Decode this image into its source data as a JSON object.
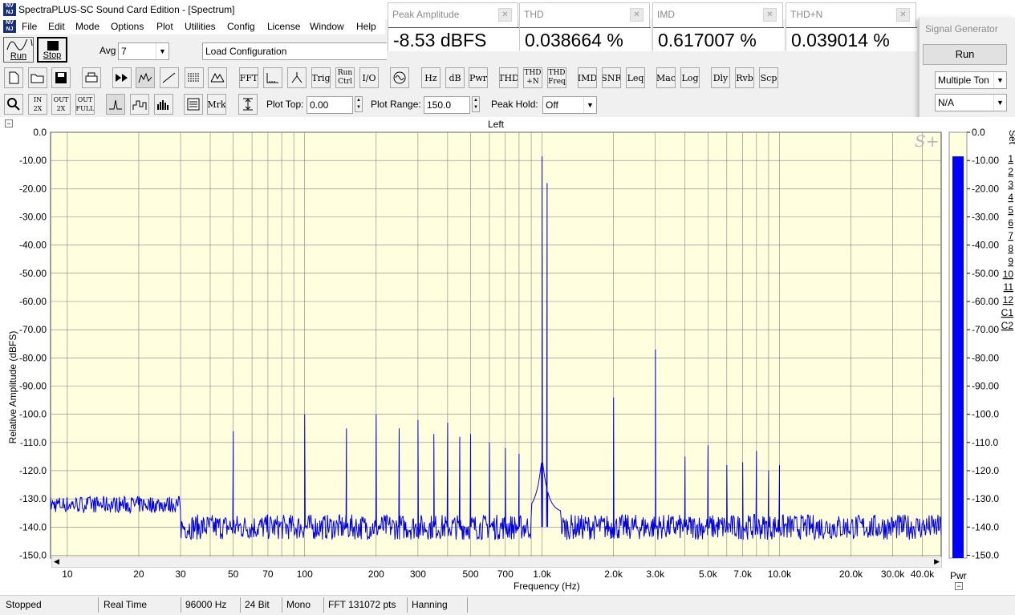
{
  "app": {
    "title": "SpectraPLUS-SC Sound Card Edition - [Spectrum]"
  },
  "menu": [
    "File",
    "Edit",
    "Mode",
    "Options",
    "Plot",
    "Utilities",
    "Config",
    "License",
    "Window",
    "Help"
  ],
  "meters": [
    {
      "label": "Peak Amplitude",
      "value": "-8.53 dBFS"
    },
    {
      "label": "THD",
      "value": "0.038664 %"
    },
    {
      "label": "IMD",
      "value": "0.617007 %"
    },
    {
      "label": "THD+N",
      "value": "0.039014 %"
    }
  ],
  "signal_generator": {
    "title": "Signal Generator",
    "run_label": "Run",
    "waveform": "Multiple Ton",
    "option": "N/A"
  },
  "toolbar": {
    "run_label": "Run",
    "stop_label": "Stop",
    "avg_label": "Avg",
    "avg_value": "7",
    "config_value": "Load Configuration",
    "buttons": [
      "FFT",
      "Trig",
      "Run Ctrl",
      "I/O",
      "Hz",
      "dB",
      "Pwr",
      "THD",
      "THD +N",
      "THD Freq",
      "IMD",
      "SNR",
      "Leq",
      "Mac",
      "Log",
      "Dly",
      "Rvb",
      "Scp"
    ],
    "zoom_buttons": [
      "Mrk"
    ],
    "plot_top_label": "Plot Top:",
    "plot_top_value": "0.00",
    "plot_range_label": "Plot Range:",
    "plot_range_value": "150.0",
    "peak_hold_label": "Peak Hold:",
    "peak_hold_value": "Off"
  },
  "plot": {
    "channel_title": "Left",
    "ylabel": "Relative Amplitude (dBFS)",
    "xlabel": "Frequency (Hz)",
    "watermark": "S+",
    "yticks": [
      "0.0",
      "-10.00",
      "-20.00",
      "-30.00",
      "-40.00",
      "-50.00",
      "-60.00",
      "-70.00",
      "-80.00",
      "-90.00",
      "-100.0",
      "-110.0",
      "-120.0",
      "-130.0",
      "-140.0",
      "-150.0"
    ],
    "xticks": [
      "10",
      "20",
      "30",
      "50",
      "70",
      "100",
      "200",
      "300",
      "500",
      "700",
      "1.0k",
      "2.0k",
      "3.0k",
      "5.0k",
      "7.0k",
      "10.0k",
      "20.0k",
      "30.0k",
      "40.0k"
    ],
    "meter_ticks": [
      "0.0",
      "-10.00",
      "-20.00",
      "-30.00",
      "-40.00",
      "-50.00",
      "-60.00",
      "-70.00",
      "-80.00",
      "-90.00",
      "-100.0",
      "-110.0",
      "-120.0",
      "-130.0",
      "-140.0",
      "-150.0"
    ],
    "meter_label": "Pwr",
    "set_label": "Set",
    "set_buttons": [
      "1",
      "2",
      "3",
      "4",
      "5",
      "6",
      "7",
      "8",
      "9",
      "10",
      "11",
      "12",
      "C1",
      "C2"
    ],
    "colors": {
      "plot_bg": "#ffffe0",
      "trace": "#0000dd",
      "grid": "#808080",
      "meter_bar": "#0000ff"
    }
  },
  "chart_data": {
    "type": "line",
    "xscale": "log",
    "xlim": [
      8.5,
      48000
    ],
    "ylim": [
      -151,
      0
    ],
    "xlabel": "Frequency (Hz)",
    "ylabel": "Relative Amplitude (dBFS)",
    "noise_floor": -140,
    "peak_meter_level": -8.53,
    "peaks": [
      {
        "f": 50,
        "db": -106
      },
      {
        "f": 100,
        "db": -100
      },
      {
        "f": 150,
        "db": -105
      },
      {
        "f": 200,
        "db": -100
      },
      {
        "f": 250,
        "db": -105
      },
      {
        "f": 300,
        "db": -102
      },
      {
        "f": 350,
        "db": -107
      },
      {
        "f": 400,
        "db": -103
      },
      {
        "f": 450,
        "db": -108
      },
      {
        "f": 500,
        "db": -107
      },
      {
        "f": 600,
        "db": -110
      },
      {
        "f": 700,
        "db": -112
      },
      {
        "f": 800,
        "db": -114
      },
      {
        "f": 1000,
        "db": -8.53
      },
      {
        "f": 1050,
        "db": -18
      },
      {
        "f": 2000,
        "db": -94
      },
      {
        "f": 3000,
        "db": -77
      },
      {
        "f": 4000,
        "db": -115
      },
      {
        "f": 5000,
        "db": -111
      },
      {
        "f": 6000,
        "db": -118
      },
      {
        "f": 7000,
        "db": -117
      },
      {
        "f": 8000,
        "db": -113
      },
      {
        "f": 9000,
        "db": -120
      },
      {
        "f": 10000,
        "db": -118
      }
    ]
  },
  "status": [
    "Stopped",
    "Real Time",
    "96000 Hz",
    "24 Bit",
    "Mono",
    "FFT 131072 pts",
    "Hanning"
  ]
}
